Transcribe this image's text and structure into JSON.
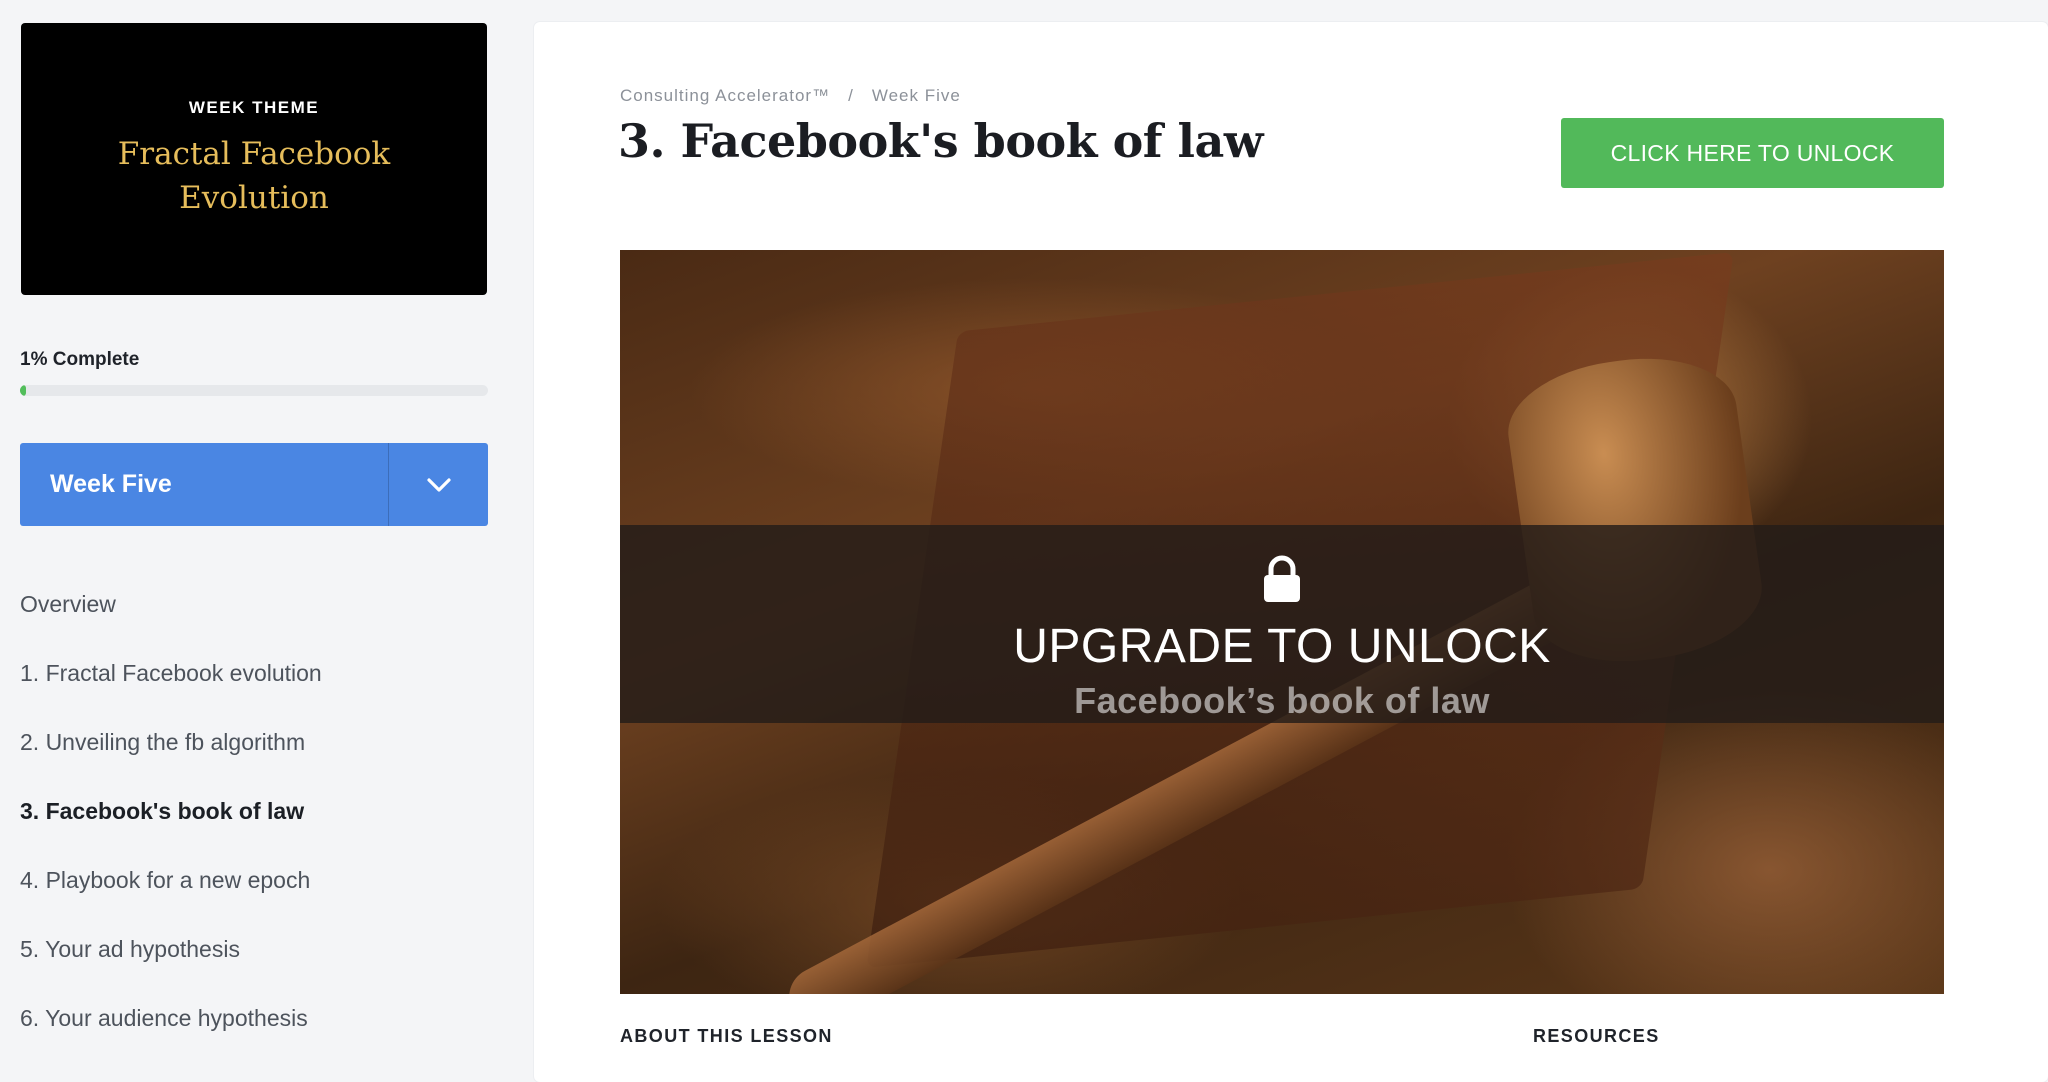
{
  "sidebar": {
    "theme_eyebrow": "WEEK THEME",
    "theme_title": "Fractal Facebook Evolution",
    "progress_label": "1% Complete",
    "progress_value": 0.01,
    "week_select": "Week Five",
    "lessons": [
      {
        "label": "Overview"
      },
      {
        "label": "1. Fractal Facebook evolution"
      },
      {
        "label": "2. Unveiling the fb algorithm"
      },
      {
        "label": "3. Facebook's book of law",
        "active": true
      },
      {
        "label": "4. Playbook for a new epoch"
      },
      {
        "label": "5. Your ad hypothesis"
      },
      {
        "label": "6. Your audience hypothesis"
      }
    ]
  },
  "main": {
    "breadcrumb": [
      "Consulting Accelerator™",
      "/",
      "Week Five"
    ],
    "title": "3. Facebook's book of law",
    "unlock_button": "CLICK HERE TO UNLOCK",
    "video": {
      "overlay_text": "UPGRADE TO UNLOCK",
      "subtitle": "Facebook’s book of law",
      "icon": "lock-icon"
    },
    "sections": {
      "about": "ABOUT THIS LESSON",
      "resources": "RESOURCES"
    }
  },
  "colors": {
    "accent_blue": "#4a86e3",
    "accent_green": "#52b95a",
    "theme_gold": "#e6bd5b"
  }
}
